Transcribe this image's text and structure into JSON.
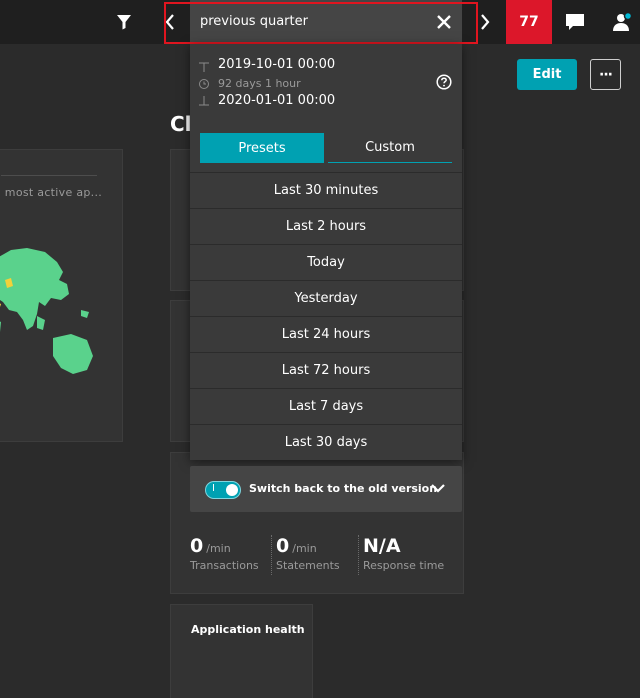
{
  "topbar": {
    "timeframe_value": "previous quarter",
    "problems_count": "77"
  },
  "dashboard": {
    "partial_title": "Cl",
    "edit_label": "Edit",
    "more_label": "···",
    "map_tile_label": "| most active ap...",
    "health_tile_title": "Application health",
    "metrics": [
      {
        "value": "0",
        "unit": "/min",
        "label": "Transactions"
      },
      {
        "value": "0",
        "unit": "/min",
        "label": "Statements"
      },
      {
        "value": "N/A",
        "unit": "",
        "label": "Response time"
      }
    ]
  },
  "timeframe": {
    "start": "2019-10-01 00:00",
    "duration": "92 days 1 hour",
    "end": "2020-01-01 00:00",
    "tabs": {
      "presets": "Presets",
      "custom": "Custom"
    },
    "presets": [
      "Last 30 minutes",
      "Last 2 hours",
      "Today",
      "Yesterday",
      "Last 24 hours",
      "Last 72 hours",
      "Last 7 days",
      "Last 30 days"
    ],
    "switch_label": "Switch back to the old version",
    "switch_on": true
  },
  "colors": {
    "accent": "#00a1b2",
    "problems": "#dc172a",
    "highlight": "#e0151f",
    "map_land": "#5ad28c"
  }
}
